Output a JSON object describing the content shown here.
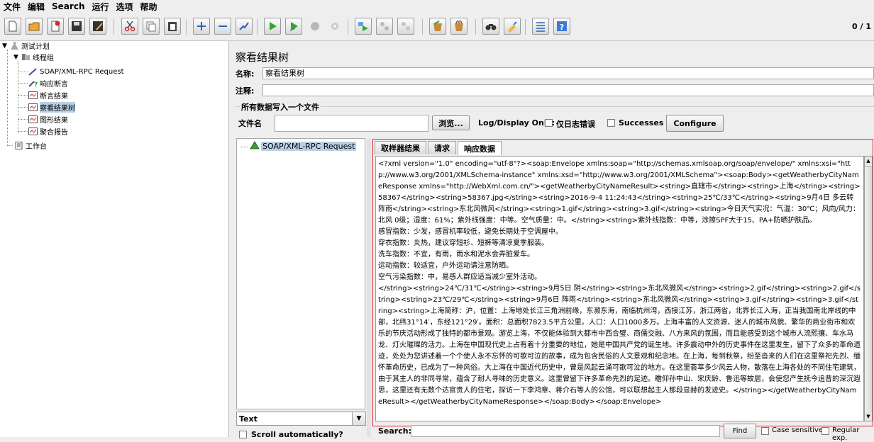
{
  "menu": [
    "文件",
    "编辑",
    "Search",
    "运行",
    "选项",
    "帮助"
  ],
  "toolbar": {
    "counter": "0 / 1",
    "icons": [
      "new-icon",
      "open-icon",
      "templates-icon",
      "save-icon",
      "save-as-icon",
      "cut-icon",
      "copy-icon",
      "paste-icon",
      "expand-icon",
      "collapse-icon",
      "toggle-icon",
      "start-icon",
      "start-no-pause-icon",
      "stop-icon",
      "shutdown-icon",
      "remote-start-icon",
      "remote-stop-icon",
      "remote-shutdown-icon",
      "clear-icon",
      "clear-all-icon",
      "search-icon",
      "reset-search-icon",
      "function-helper-icon",
      "help-icon"
    ]
  },
  "tree": {
    "plan": "测试计划",
    "group": "线程组",
    "items": [
      "SOAP/XML-RPC Request",
      "响应断言",
      "断言结果",
      "察看结果树",
      "图形结果",
      "聚合报告"
    ],
    "workbench": "工作台"
  },
  "panel": {
    "title": "察看结果树",
    "name_label": "名称:",
    "name_value": "察看结果树",
    "comment_label": "注释:",
    "comment_value": "",
    "group_title": "所有数据写入一个文件",
    "file_label": "文件名",
    "file_value": "",
    "browse": "浏览...",
    "log_display": "Log/Display Only:",
    "errors_only": "仅日志错误",
    "successes": "Successes",
    "configure": "Configure"
  },
  "results": {
    "sample": "SOAP/XML-RPC Request",
    "renderer": "Text",
    "scroll_auto": "Scroll automatically?",
    "tabs": [
      "取样器结果",
      "请求",
      "响应数据"
    ],
    "active_tab": 2,
    "response_text": "<?xml version=\"1.0\" encoding=\"utf-8\"?><soap:Envelope xmlns:soap=\"http://schemas.xmlsoap.org/soap/envelope/\" xmlns:xsi=\"http://www.w3.org/2001/XMLSchema-instance\" xmlns:xsd=\"http://www.w3.org/2001/XMLSchema\"><soap:Body><getWeatherbyCityNameResponse xmlns=\"http://WebXml.com.cn/\"><getWeatherbyCityNameResult><string>直辖市</string><string>上海</string><string>58367</string><string>58367.jpg</string><string>2016-9-4 11:24:43</string><string>25℃/33℃</string><string>9月4日 多云转阵雨</string><string>东北风微风</string><string>1.gif</string><string>3.gif</string><string>今日天气实况：气温：30℃；风向/风力：北风 0级；湿度：61%；紫外线强度：中等。空气质量：中。</string><string>紫外线指数：中等，涂擦SPF大于15、PA+防晒护肤品。\n感冒指数：少发，感冒机率较低，避免长期处于空调屋中。\n穿衣指数：炎热，建议穿短衫、短裤等清凉夏季服装。\n洗车指数：不宜，有雨，雨水和泥水会弄脏爱车。\n运动指数：较适宜，户外运动请注意防晒。\n空气污染指数：中，易感人群应适当减少室外活动。\n</string><string>24℃/31℃</string><string>9月5日 阴</string><string>东北风微风</string><string>2.gif</string><string>2.gif</string><string>23℃/29℃</string><string>9月6日 阵雨</string><string>东北风微风</string><string>3.gif</string><string>3.gif</string><string>上海简称：沪，位置：上海地处长江三角洲前缘，东濒东海，南临杭州湾，西接江苏，浙江两省，北界长江入海，正当我国南北岸线的中部，北纬31°14′，东经121°29′。面积：总面积7823.5平方公里。人口：人口1000多万。上海丰富的人文资源、迷人的城市风貌、繁华的商业街市和欢乐的节庆活动形成了独特的都市景观。游览上海，不仅能体验到大都市中西合璧、商儒交融、八方来风的氛围，而且能感受到这个城市人流熙攘、车水马龙、灯火璀璨的活力。上海在中国现代史上占有着十分重要的地位，她是中国共产党的诞生地。许多震动中外的历史事件在这里发生，留下了众多的革命遗迹，处处为您讲述着一个个使人永不忘怀的可歌可泣的故事，成为包含民俗的人文景观和纪念地。在上海，每到秋祭，纷至沓来的人们在这里祭祀先烈、缅怀革命历史，已成为了一种风俗。大上海在中国近代历史中，曾是风起云涌可歌可泣的地方。在这里荟萃多少风云人物，散落在上海各处的不同住宅建筑，由于其主人的非同寻常，蕴含了耐人寻味的历史意义。这里曾留下许多革命先烈的足迹。瞻仰孙中山、宋庆龄、鲁迅等故居，会使您产生抚今追昔的深沉遐思，这里还有无数个达官贵人的住宅，探访一下李鸿章、蒋介石等人的公馆，可以联想起主人那段显赫的发迹史。</string></getWeatherbyCityNameResult></getWeatherbyCityNameResponse></soap:Body></soap:Envelope>",
    "search_label": "Search:",
    "search_value": "",
    "find": "Find",
    "case_sensitive": "Case sensitive",
    "regular_exp": "Regular exp."
  }
}
